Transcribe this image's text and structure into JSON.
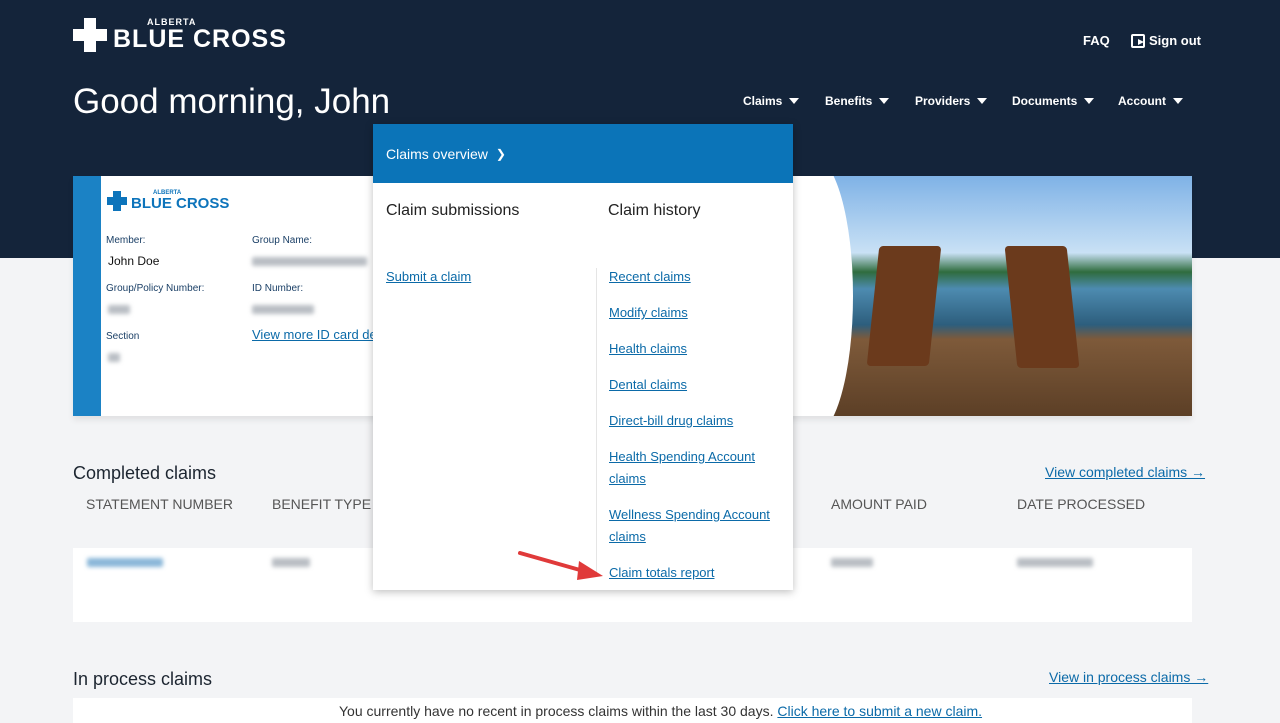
{
  "header": {
    "logo_small": "ALBERTA",
    "logo_big": "BLUE CROSS",
    "faq": "FAQ",
    "sign_out": "Sign out",
    "greeting": "Good morning, John",
    "nav": [
      "Claims",
      "Benefits",
      "Providers",
      "Documents",
      "Account"
    ]
  },
  "id_card": {
    "logo_small": "ALBERTA",
    "logo_big": "BLUE CROSS",
    "member_label": "Member:",
    "member_value": "John Doe",
    "group_name_label": "Group Name:",
    "policy_label": "Group/Policy Number:",
    "id_label": "ID Number:",
    "section_label": "Section",
    "more_link": "View more ID card de"
  },
  "dropdown": {
    "overview": "Claims overview",
    "submissions_title": "Claim submissions",
    "history_title": "Claim history",
    "submit_link": "Submit a claim",
    "history_links": [
      "Recent claims",
      "Modify claims",
      "Health claims",
      "Dental claims",
      "Direct-bill drug claims",
      "Health Spending Account claims",
      "Wellness Spending Account claims",
      "Claim totals report"
    ]
  },
  "completed": {
    "title": "Completed claims",
    "view_link": "View completed claims →",
    "columns": [
      "STATEMENT NUMBER",
      "BENEFIT TYPE",
      "AMOUNT PAID",
      "DATE PROCESSED"
    ]
  },
  "in_process": {
    "title": "In process claims",
    "view_link": "View in process claims →",
    "message": "You currently have no recent in process claims within the last 30 days.",
    "submit_link": "Click here to submit a new claim."
  },
  "colors": {
    "navy": "#14243a",
    "brand_blue": "#0b74b8",
    "link": "#0b6aa8",
    "arrow": "#e03a3a"
  }
}
